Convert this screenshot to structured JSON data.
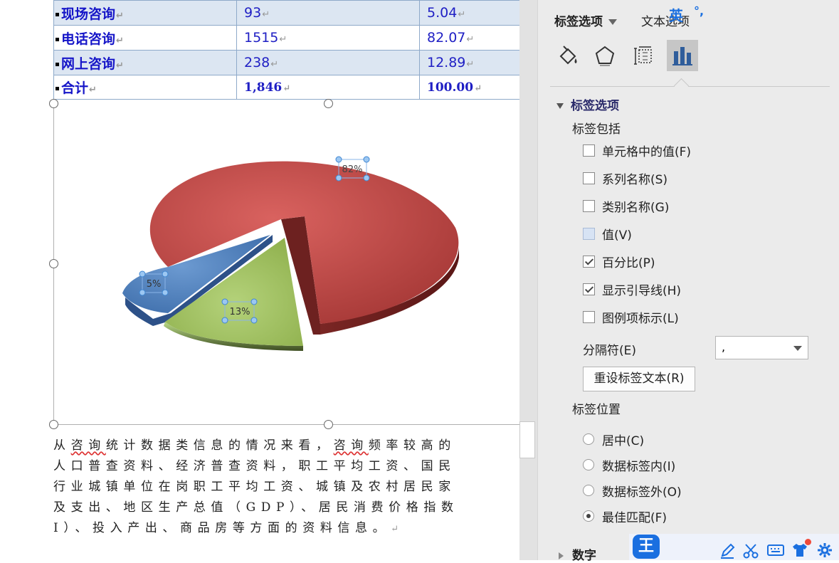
{
  "table": {
    "rows": [
      {
        "name": "现场咨询",
        "count": "93",
        "pct": "5.04",
        "shaded": true
      },
      {
        "name": "电话咨询",
        "count": "1515",
        "pct": "82.07",
        "shaded": false
      },
      {
        "name": "网上咨询",
        "count": "238",
        "pct": "12.89",
        "shaded": true
      }
    ],
    "total": {
      "name": "合计",
      "count": "1,846",
      "pct": "100.00"
    }
  },
  "chart_data": {
    "type": "pie",
    "style": "3d-exploded",
    "slices": [
      {
        "label": "电话咨询",
        "value": 82.07,
        "data_label": "82%",
        "color": "#c0504d"
      },
      {
        "label": "现场咨询",
        "value": 5.04,
        "data_label": "5%",
        "color": "#4f81bd"
      },
      {
        "label": "网上咨询",
        "value": 12.89,
        "data_label": "13%",
        "color": "#9bbb59"
      }
    ]
  },
  "paragraph": {
    "lines": [
      {
        "pre": "从",
        "u1": "咨询",
        "mid": "统计数据类信息的情况来看，",
        "u2": "咨询",
        "post": "频率较高的"
      },
      {
        "pre": "人口普查资料、经济普查资料，职工平均工资、国民",
        "u1": "",
        "mid": "",
        "u2": "",
        "post": ""
      },
      {
        "pre": "行业城镇单位在岗职工平均工资、城镇及农村居民家",
        "u1": "",
        "mid": "",
        "u2": "",
        "post": ""
      },
      {
        "pre": "及支出、地区生产总值（GDP）、居民消费价格指数",
        "u1": "",
        "mid": "",
        "u2": "",
        "post": ""
      },
      {
        "pre": "I）、投入产出、商品房等方面的资料信息。",
        "u1": "",
        "mid": "",
        "u2": "",
        "post": ""
      }
    ]
  },
  "pane": {
    "tabs": {
      "label_options": "标签选项",
      "text_options": "文本选项"
    },
    "icons": [
      "paint-bucket-icon",
      "pentagon-icon",
      "size-layout-icon",
      "bar-chart-icon"
    ],
    "section_title": "标签选项",
    "label_contains": "标签包括",
    "checkboxes": [
      {
        "label": "单元格中的值(F)",
        "state": "unchecked"
      },
      {
        "label": "系列名称(S)",
        "state": "unchecked"
      },
      {
        "label": "类别名称(G)",
        "state": "unchecked"
      },
      {
        "label": "值(V)",
        "state": "partial"
      },
      {
        "label": "百分比(P)",
        "state": "checked"
      },
      {
        "label": "显示引导线(H)",
        "state": "checked"
      },
      {
        "label": "图例项标示(L)",
        "state": "unchecked"
      }
    ],
    "separator_label": "分隔符(E)",
    "separator_value": ",",
    "reset_button": "重设标签文本(R)",
    "position_title": "标签位置",
    "radios": [
      {
        "label": "居中(C)",
        "selected": false
      },
      {
        "label": "数据标签内(I)",
        "selected": false
      },
      {
        "label": "数据标签外(O)",
        "selected": false
      },
      {
        "label": "最佳匹配(F)",
        "selected": true
      }
    ],
    "number_section": "数字"
  },
  "ime": {
    "logo": "王",
    "lang": "英"
  }
}
